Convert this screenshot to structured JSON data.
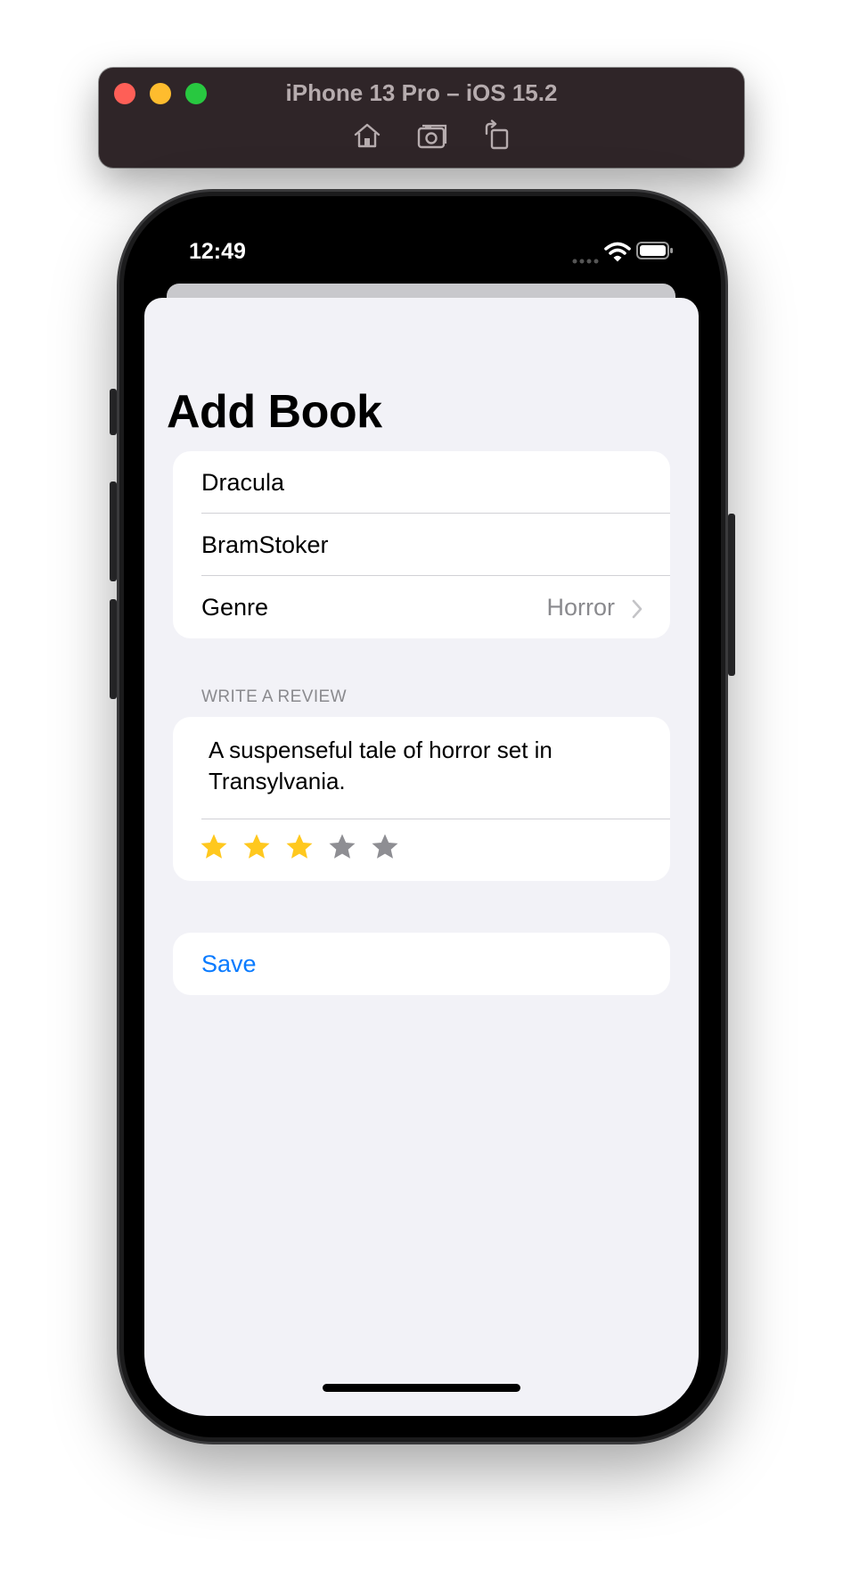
{
  "simulator": {
    "title": "iPhone 13 Pro – iOS 15.2",
    "toolbar": [
      {
        "icon": "home-icon"
      },
      {
        "icon": "screenshot-icon"
      },
      {
        "icon": "rotate-icon"
      }
    ]
  },
  "status_bar": {
    "time": "12:49"
  },
  "screen": {
    "title": "Add Book",
    "form": {
      "title_value": "Dracula",
      "author_value": "BramStoker",
      "genre_label": "Genre",
      "genre_value": "Horror"
    },
    "review_section": {
      "header": "WRITE A REVIEW",
      "review_text": "A suspenseful tale of horror set in Transylvania.",
      "rating": 3,
      "max_rating": 5,
      "star_on_color": "#ffc81e",
      "star_off_color": "#8e8e93"
    },
    "save_label": "Save"
  },
  "colors": {
    "accent": "#0a7bff",
    "background": "#f2f2f7",
    "secondary_text": "#8a8a8e"
  }
}
